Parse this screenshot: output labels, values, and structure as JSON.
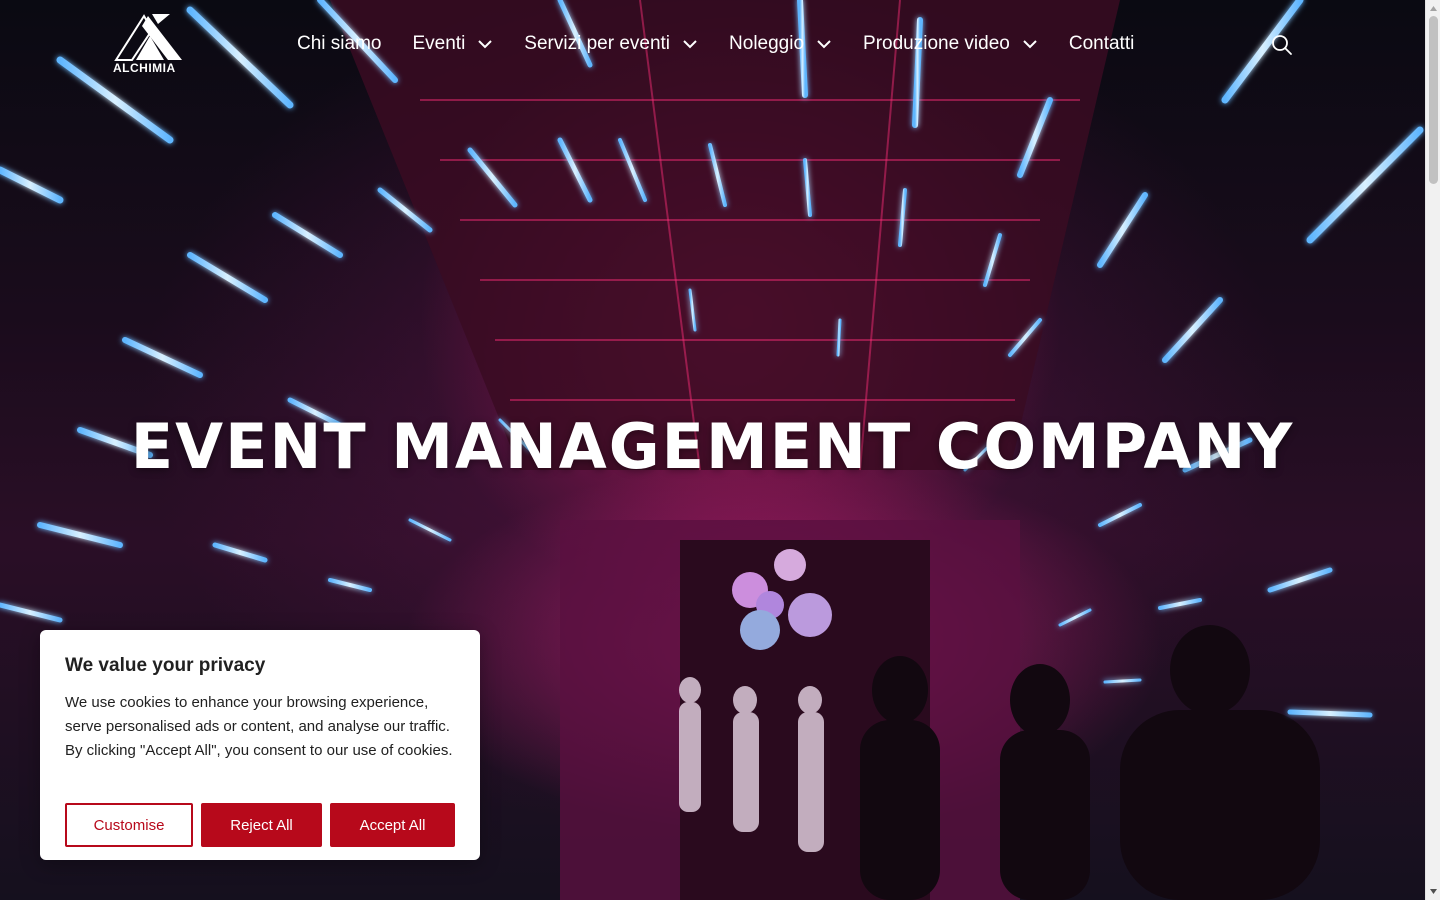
{
  "brand": {
    "name": "ALCHIMIA"
  },
  "nav": {
    "items": [
      {
        "label": "Chi siamo",
        "dropdown": false
      },
      {
        "label": "Eventi",
        "dropdown": true
      },
      {
        "label": "Servizi per eventi",
        "dropdown": true
      },
      {
        "label": "Noleggio",
        "dropdown": true
      },
      {
        "label": "Produzione video",
        "dropdown": true
      },
      {
        "label": "Contatti",
        "dropdown": false
      }
    ],
    "search_icon": "search-icon"
  },
  "hero": {
    "headline": "EVENT MANAGEMENT COMPANY"
  },
  "cookie_banner": {
    "title": "We value your privacy",
    "text": "We use cookies to enhance your browsing experience, serve personalised ads or content, and analyse our traffic. By clicking \"Accept All\", you consent to our use of cookies.",
    "customise_label": "Customise",
    "reject_label": "Reject All",
    "accept_label": "Accept All",
    "accent_color": "#b7091b"
  }
}
